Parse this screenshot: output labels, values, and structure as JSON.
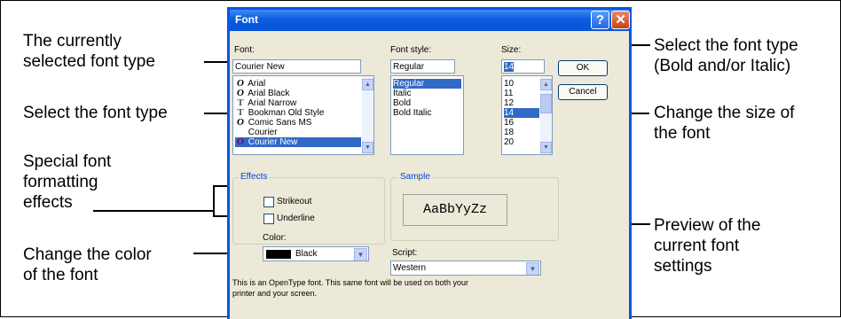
{
  "annotations": {
    "selected_font": [
      "The currently",
      "selected font type"
    ],
    "select_font": "Select the font type",
    "effects": [
      "Special font",
      "formatting",
      "effects"
    ],
    "color": [
      "Change the color",
      "of the font"
    ],
    "style": [
      "Select the font type",
      "(Bold and/or Italic)"
    ],
    "size": [
      "Change the size of",
      "the font"
    ],
    "preview": [
      "Preview of the",
      "current font",
      "settings"
    ]
  },
  "dialog": {
    "title": "Font",
    "help_label": "?",
    "close_label": "✕",
    "font_label": "Font:",
    "font_value": "Courier New",
    "fonts": [
      {
        "name": "Arial",
        "icon": "O"
      },
      {
        "name": "Arial Black",
        "icon": "O"
      },
      {
        "name": "Arial Narrow",
        "icon": "T"
      },
      {
        "name": "Bookman Old Style",
        "icon": "T"
      },
      {
        "name": "Comic Sans MS",
        "icon": "O"
      },
      {
        "name": "Courier",
        "icon": ""
      },
      {
        "name": "Courier New",
        "icon": "O"
      }
    ],
    "style_label": "Font style:",
    "style_value": "Regular",
    "styles": [
      "Regular",
      "Italic",
      "Bold",
      "Bold Italic"
    ],
    "size_label": "Size:",
    "size_value": "14",
    "sizes": [
      "10",
      "11",
      "12",
      "14",
      "16",
      "18",
      "20"
    ],
    "ok_label": "OK",
    "cancel_label": "Cancel",
    "effects_title": "Effects",
    "strikeout_label": "Strikeout",
    "underline_label": "Underline",
    "color_label": "Color:",
    "color_value": "Black",
    "sample_title": "Sample",
    "sample_text": "AaBbYyZz",
    "script_label": "Script:",
    "script_value": "Western",
    "note": "This is an OpenType font. This same font will be used on both your printer and your screen."
  }
}
